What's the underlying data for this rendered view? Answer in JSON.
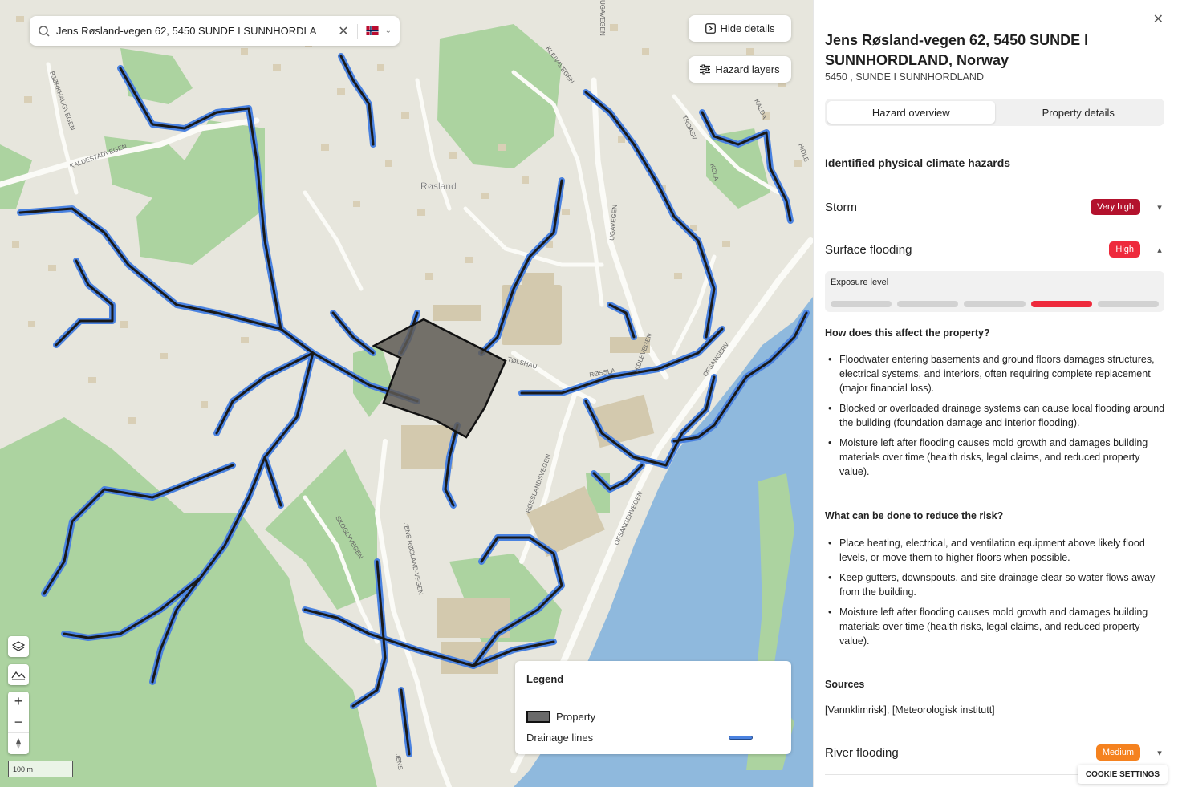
{
  "map": {
    "search": {
      "value": "Jens Røsland-vegen 62, 5450 SUNDE I SUNNHORDLA",
      "clear_icon": "close-icon",
      "country_flag": "norway-flag-icon"
    },
    "buttons": {
      "hide_details": "Hide details",
      "hazard_layers": "Hazard layers"
    },
    "place_label": "Røsland",
    "road_labels": {
      "bjorkhaugvegen": "BJØRKHAUGVEGEN",
      "kaldestadvegen": "KALDESTADVEGEN",
      "kleivavegen": "KLEIVAVEGEN",
      "ugavegen_top": "UGAVEGEN",
      "ugavegen_mid": "UGAVEGEN",
      "troasv": "TROASV",
      "kalda": "KALDA",
      "kola": "KOLA",
      "hidle": "HIDLE",
      "tolshau": "TØLSHAU",
      "rossla": "RØSSLA",
      "hidlevegen": "HIDLEVEGEN",
      "ofsanger_top": "OFSANGERV",
      "rosslandsvegen": "RØSSLANDSVEGEN",
      "ofsangervegen": "OFSANGERVEGEN",
      "skoglyvegen": "SKOGLYVEGEN",
      "jens_rosland_vegen": "JENS RØSLAND-VEGEN",
      "jens_bottom": "JENS"
    },
    "controls": {
      "layers_icon": "layers-icon",
      "terrain_icon": "terrain-icon",
      "zoom_in": "+",
      "zoom_out": "−",
      "compass_icon": "compass-icon"
    },
    "scale_label": "100 m",
    "legend": {
      "title": "Legend",
      "items": [
        {
          "label": "Property",
          "color": "#6a6a6a"
        },
        {
          "label": "Drainage lines",
          "color": "#4a82e0"
        }
      ]
    },
    "colors": {
      "land": "#e7e6dd",
      "forest": "#acd3a0",
      "water": "#8fb9dd",
      "building": "#d3c9ae",
      "drainage": "#4a82e0",
      "drainage_core": "#1a1a1a"
    }
  },
  "panel": {
    "close_icon": "close-icon",
    "title": "Jens Røsland-vegen 62, 5450 SUNDE I SUNNHORDLAND, Norway",
    "subtitle": "5450 , SUNDE I SUNNHORDLAND",
    "tabs": [
      {
        "label": "Hazard overview",
        "active": true
      },
      {
        "label": "Property details",
        "active": false
      }
    ],
    "section_heading": "Identified physical climate hazards",
    "hazards": {
      "storm": {
        "name": "Storm",
        "level": "Very high",
        "color": "#b3122d",
        "expanded": false
      },
      "surface": {
        "name": "Surface flooding",
        "level": "High",
        "color": "#ee2a3c",
        "expanded": true
      },
      "river": {
        "name": "River flooding",
        "level": "Medium",
        "color": "#f5821f",
        "expanded": false
      }
    },
    "exposure": {
      "label": "Exposure level",
      "level": 4,
      "max": 5
    },
    "affect": {
      "question": "How does this affect the property?",
      "items": [
        "Floodwater entering basements and ground floors damages structures, electrical systems, and interiors, often requiring complete replacement (major financial loss).",
        "Blocked or overloaded drainage systems can cause local flooding around the building (foundation damage and interior flooding).",
        "Moisture left after flooding causes mold growth and damages building materials over time (health risks, legal claims, and reduced property value)."
      ]
    },
    "reduce": {
      "question": "What can be done to reduce the risk?",
      "items": [
        "Place heating, electrical, and ventilation equipment above likely flood levels, or move them to higher floors when possible.",
        "Keep gutters, downspouts, and site drainage clear so water flows away from the building.",
        "Moisture left after flooding causes mold growth and damages building materials over time (health risks, legal claims, and reduced property value)."
      ]
    },
    "sources": {
      "heading": "Sources",
      "value": "[Vannklimrisk], [Meteorologisk institutt]"
    },
    "cookie_settings": "COOKIE SETTINGS"
  }
}
